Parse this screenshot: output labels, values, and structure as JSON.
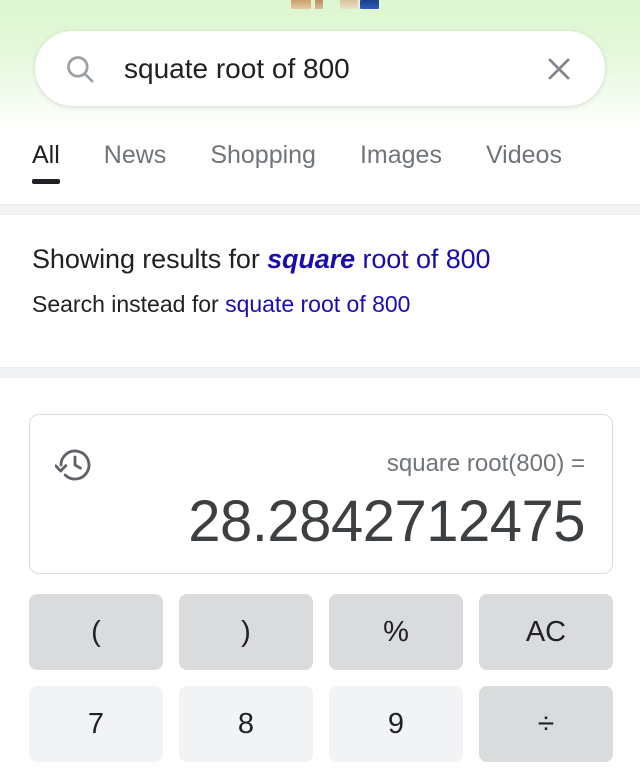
{
  "theme": {
    "header_gradient_top": "#ddf6d0",
    "link_color": "#1a0dab",
    "text_color": "#202124",
    "muted_text_color": "#70757a",
    "function_key_bg": "#d9dbdd",
    "number_key_bg": "#f1f3f4",
    "card_border": "#dadce0",
    "separator_bg": "#f1f3f4"
  },
  "search": {
    "value": "squate root of 800",
    "placeholder": "Search",
    "search_icon": "search-icon",
    "clear_icon": "close-icon"
  },
  "tabs": [
    {
      "label": "All",
      "active": true
    },
    {
      "label": "News",
      "active": false
    },
    {
      "label": "Shopping",
      "active": false
    },
    {
      "label": "Images",
      "active": false
    },
    {
      "label": "Videos",
      "active": false
    }
  ],
  "spelling": {
    "showing_lead": "Showing results for ",
    "showing_corrected": "square",
    "showing_rest": " root of 800",
    "instead_lead": "Search instead for ",
    "instead_link": "squate root of 800"
  },
  "calculator": {
    "history_icon": "history-icon",
    "expression": "square root(800) =",
    "result": "28.2842712475",
    "keys": [
      {
        "label": "(",
        "name": "key-open-paren",
        "type": "fn"
      },
      {
        "label": ")",
        "name": "key-close-paren",
        "type": "fn"
      },
      {
        "label": "%",
        "name": "key-percent",
        "type": "fn"
      },
      {
        "label": "AC",
        "name": "key-all-clear",
        "type": "fn"
      },
      {
        "label": "7",
        "name": "key-7",
        "type": "num"
      },
      {
        "label": "8",
        "name": "key-8",
        "type": "num"
      },
      {
        "label": "9",
        "name": "key-9",
        "type": "num"
      },
      {
        "label": "÷",
        "name": "key-divide",
        "type": "op"
      }
    ]
  }
}
